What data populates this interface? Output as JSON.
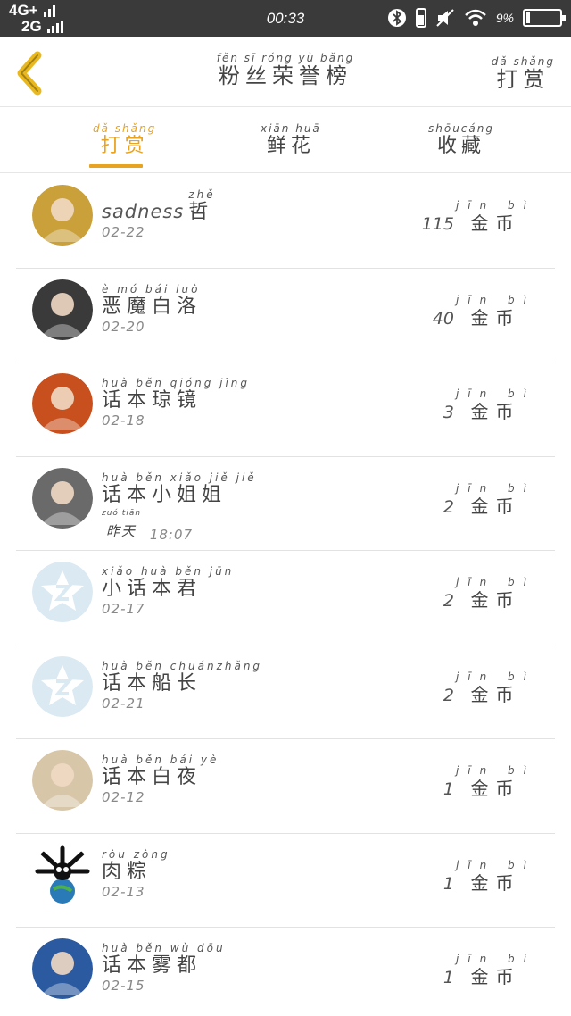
{
  "status_bar": {
    "network_top": "4G+",
    "network_bottom": "2G",
    "time": "00:33",
    "battery": "9%"
  },
  "header": {
    "title_pinyin": "fěn sī róng yù bǎng",
    "title": "粉丝荣誉榜",
    "action_pinyin": "dǎ shǎng",
    "action": "打赏"
  },
  "tabs": [
    {
      "pinyin": "dǎ shǎng",
      "label": "打赏",
      "active": true
    },
    {
      "pinyin": "xiān huā",
      "label": "鲜花",
      "active": false
    },
    {
      "pinyin": "shōucáng",
      "label": "收藏",
      "active": false
    }
  ],
  "currency": {
    "pinyin": "jīn bì",
    "label": "金币"
  },
  "fans": [
    {
      "name_latin": "sadness",
      "name_pinyin": "zhě",
      "name": "哲",
      "date": "02-22",
      "amount": "115",
      "avatar_color": "#c9a03a"
    },
    {
      "name_latin": "",
      "name_pinyin": "è mó bái luò",
      "name": "恶魔白洛",
      "date": "02-20",
      "amount": "40",
      "avatar_color": "#3a3a3a"
    },
    {
      "name_latin": "",
      "name_pinyin": "huà běn qióng jìng",
      "name": "话本琼镜",
      "date": "02-18",
      "amount": "3",
      "avatar_color": "#c8501e"
    },
    {
      "name_latin": "",
      "name_pinyin": "huà běn xiǎo jiě jiě",
      "name": "话本小姐姐",
      "date_pinyin": "zuó tiān",
      "date_word": "昨天",
      "date": "18:07",
      "amount": "2",
      "avatar_color": "#6a6a6a"
    },
    {
      "name_latin": "",
      "name_pinyin": "xiǎo huà běn jūn",
      "name": "小话本君",
      "date": "02-17",
      "amount": "2",
      "avatar_color": "#dbe9f2"
    },
    {
      "name_latin": "",
      "name_pinyin": "huà běn chuánzhǎng",
      "name": "话本船长",
      "date": "02-21",
      "amount": "2",
      "avatar_color": "#dbe9f2"
    },
    {
      "name_latin": "",
      "name_pinyin": "huà běn bái yè",
      "name": "话本白夜",
      "date": "02-12",
      "amount": "1",
      "avatar_color": "#d8c6a8"
    },
    {
      "name_latin": "",
      "name_pinyin": "ròu zòng",
      "name": "肉粽",
      "date": "02-13",
      "amount": "1",
      "avatar_color": "#ffffff"
    },
    {
      "name_latin": "",
      "name_pinyin": "huà běn wù dōu",
      "name": "话本雾都",
      "date": "02-15",
      "amount": "1",
      "avatar_color": "#2c5aa0"
    }
  ],
  "colors": {
    "accent": "#e8a321",
    "status_bar": "#3a3a3a",
    "divider": "#e2e2e2"
  }
}
